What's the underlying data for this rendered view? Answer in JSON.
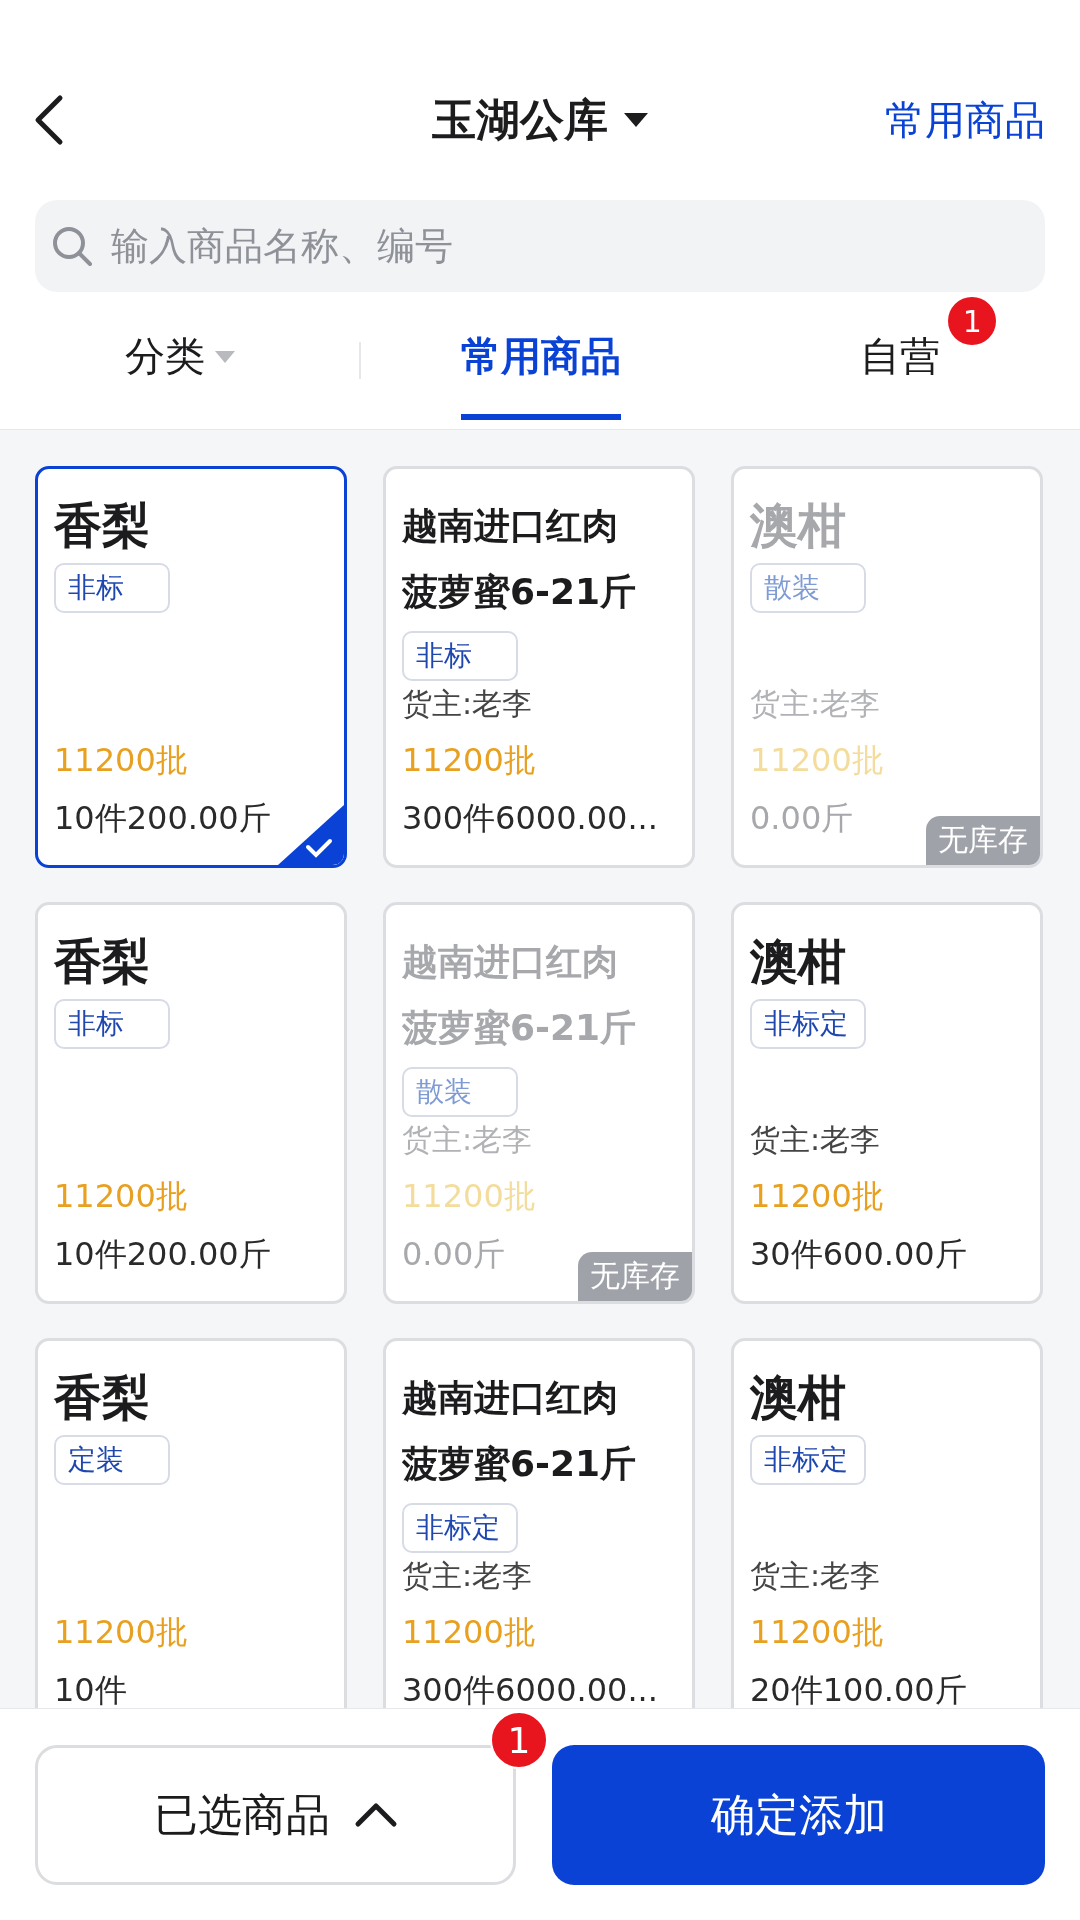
{
  "header": {
    "title": "玉湖公库",
    "action": "常用商品"
  },
  "search": {
    "placeholder": "输入商品名称、编号"
  },
  "tabs": [
    {
      "label": "分类",
      "kind": "dropdown",
      "selected": false
    },
    {
      "label": "常用商品",
      "kind": "plain",
      "selected": true
    },
    {
      "label": "自营",
      "kind": "badge",
      "badge": "1",
      "selected": false
    }
  ],
  "products": [
    {
      "name": "香梨",
      "tag": "非标",
      "price": "11200批",
      "stock": "10件200.00斤",
      "in_stock": true,
      "selected": true
    },
    {
      "name": "越南进口红肉菠萝蜜6-21斤",
      "tag": "非标",
      "owner": "货主:老李",
      "price": "11200批",
      "stock": "300件6000.00...",
      "in_stock": true,
      "selected": false
    },
    {
      "name": "澳柑",
      "tag": "散装",
      "owner": "货主:老李",
      "price": "11200批",
      "stock": "0.00斤",
      "in_stock": false,
      "stock_badge": "无库存",
      "selected": false
    },
    {
      "name": "香梨",
      "tag": "非标",
      "price": "11200批",
      "stock": "10件200.00斤",
      "in_stock": true,
      "selected": false
    },
    {
      "name": "越南进口红肉菠萝蜜6-21斤",
      "tag": "散装",
      "owner": "货主:老李",
      "price": "11200批",
      "stock": "0.00斤",
      "in_stock": false,
      "stock_badge": "无库存",
      "selected": false
    },
    {
      "name": "澳柑",
      "tag": "非标定",
      "owner": "货主:老李",
      "price": "11200批",
      "stock": "30件600.00斤",
      "in_stock": true,
      "selected": false
    },
    {
      "name": "香梨",
      "tag": "定装",
      "price": "11200批",
      "stock": "10件",
      "in_stock": true,
      "selected": false
    },
    {
      "name": "越南进口红肉菠萝蜜6-21斤",
      "tag": "非标定",
      "owner": "货主:老李",
      "price": "11200批",
      "stock": "300件6000.00...",
      "in_stock": true,
      "selected": false
    },
    {
      "name": "澳柑",
      "tag": "非标定",
      "owner": "货主:老李",
      "price": "11200批",
      "stock": "20件100.00斤",
      "in_stock": true,
      "selected": false
    }
  ],
  "footer": {
    "selected_button": "已选商品",
    "selected_count": "1",
    "confirm_button": "确定添加"
  }
}
